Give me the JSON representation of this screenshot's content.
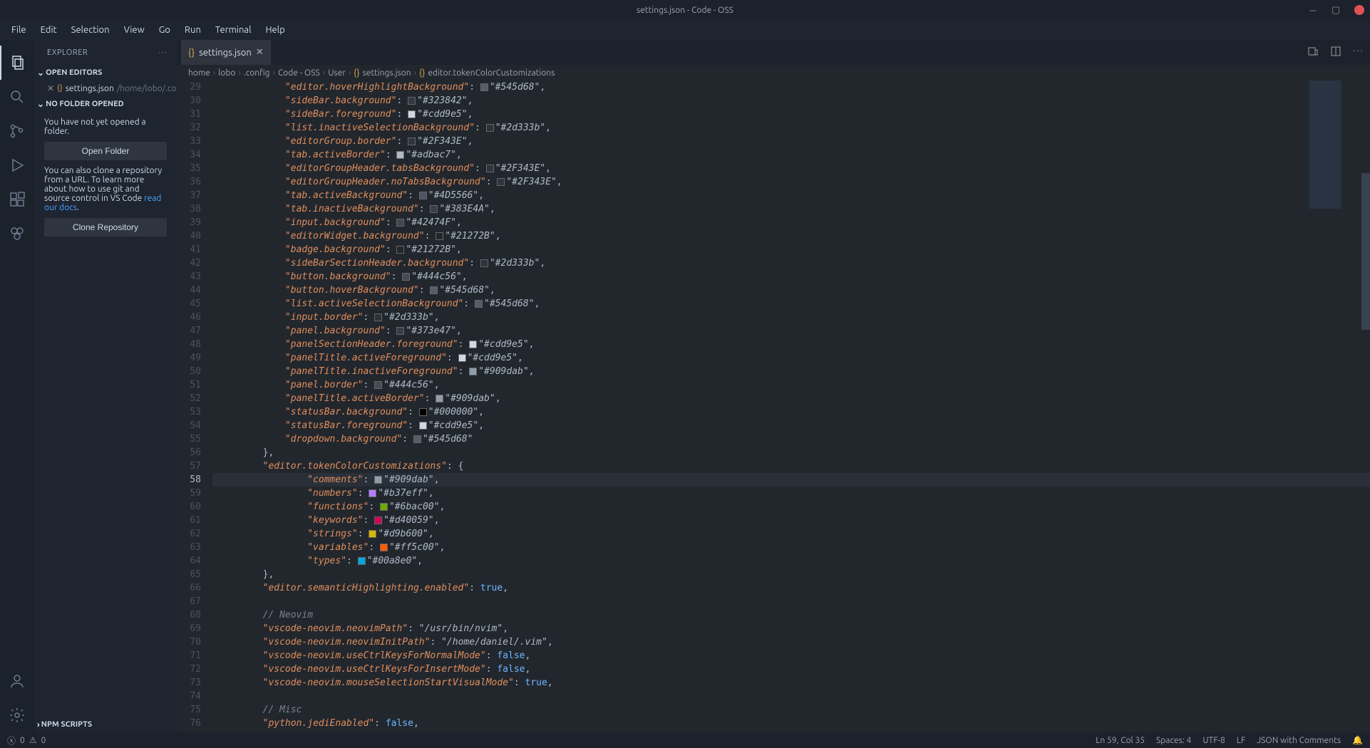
{
  "title": "settings.json - Code - OSS",
  "menubar": [
    "File",
    "Edit",
    "Selection",
    "View",
    "Go",
    "Run",
    "Terminal",
    "Help"
  ],
  "sidebar": {
    "header": "EXPLORER",
    "open_editors": "OPEN EDITORS",
    "open_item_name": "settings.json",
    "open_item_path": "/home/lobo/.config/Co...",
    "no_folder": "NO FOLDER OPENED",
    "msg1": "You have not yet opened a folder.",
    "btn_open": "Open Folder",
    "msg2_a": "You can also clone a repository from a URL. To learn more about how to use git and source control in VS Code ",
    "msg2_link": "read our docs",
    "msg2_b": ".",
    "btn_clone": "Clone Repository",
    "npm_scripts": "NPM SCRIPTS"
  },
  "tab_name": "settings.json",
  "breadcrumb": [
    "home",
    "lobo",
    ".config",
    "Code - OSS",
    "User",
    "settings.json",
    "editor.tokenColorCustomizations"
  ],
  "code_start_line": 29,
  "code": [
    {
      "indent": 3,
      "key": "editor.hoverHighlightBackground",
      "val": "#545d68",
      "comma": true
    },
    {
      "indent": 3,
      "key": "sideBar.background",
      "val": "#323842",
      "comma": true
    },
    {
      "indent": 3,
      "key": "sideBar.foreground",
      "val": "#cdd9e5",
      "comma": true
    },
    {
      "indent": 3,
      "key": "list.inactiveSelectionBackground",
      "val": "#2d333b",
      "comma": true
    },
    {
      "indent": 3,
      "key": "editorGroup.border",
      "val": "#2F343E",
      "comma": true
    },
    {
      "indent": 3,
      "key": "tab.activeBorder",
      "val": "#adbac7",
      "comma": true
    },
    {
      "indent": 3,
      "key": "editorGroupHeader.tabsBackground",
      "val": "#2F343E",
      "comma": true
    },
    {
      "indent": 3,
      "key": "editorGroupHeader.noTabsBackground",
      "val": "#2F343E",
      "comma": true
    },
    {
      "indent": 3,
      "key": "tab.activeBackground",
      "val": "#4D5566",
      "comma": true
    },
    {
      "indent": 3,
      "key": "tab.inactiveBackground",
      "val": "#383E4A",
      "comma": true
    },
    {
      "indent": 3,
      "key": "input.background",
      "val": "#42474F",
      "comma": true
    },
    {
      "indent": 3,
      "key": "editorWidget.background",
      "val": "#21272B",
      "comma": true
    },
    {
      "indent": 3,
      "key": "badge.background",
      "val": "#21272B",
      "comma": true
    },
    {
      "indent": 3,
      "key": "sideBarSectionHeader.background",
      "val": "#2d333b",
      "comma": true
    },
    {
      "indent": 3,
      "key": "button.background",
      "val": "#444c56",
      "comma": true
    },
    {
      "indent": 3,
      "key": "button.hoverBackground",
      "val": "#545d68",
      "comma": true
    },
    {
      "indent": 3,
      "key": "list.activeSelectionBackground",
      "val": "#545d68",
      "comma": true
    },
    {
      "indent": 3,
      "key": "input.border",
      "val": "#2d333b",
      "comma": true
    },
    {
      "indent": 3,
      "key": "panel.background",
      "val": "#373e47",
      "comma": true
    },
    {
      "indent": 3,
      "key": "panelSectionHeader.foreground",
      "val": "#cdd9e5",
      "comma": true
    },
    {
      "indent": 3,
      "key": "panelTitle.activeForeground",
      "val": "#cdd9e5",
      "comma": true
    },
    {
      "indent": 3,
      "key": "panelTitle.inactiveForeground",
      "val": "#909dab",
      "comma": true
    },
    {
      "indent": 3,
      "key": "panel.border",
      "val": "#444c56",
      "comma": true
    },
    {
      "indent": 3,
      "key": "panelTitle.activeBorder",
      "val": "#909dab",
      "comma": true
    },
    {
      "indent": 3,
      "key": "statusBar.background",
      "val": "#000000",
      "comma": true
    },
    {
      "indent": 3,
      "key": "statusBar.foreground",
      "val": "#cdd9e5",
      "comma": true
    },
    {
      "indent": 3,
      "key": "dropdown.background",
      "val": "#545d68",
      "comma": false
    },
    {
      "indent": 2,
      "raw": "},"
    },
    {
      "indent": 2,
      "key": "editor.tokenColorCustomizations",
      "open": true
    },
    {
      "indent": 4,
      "key": "comments",
      "val": "#909dab",
      "comma": true,
      "hl": true
    },
    {
      "indent": 4,
      "key": "numbers",
      "val": "#b37eff",
      "comma": true
    },
    {
      "indent": 4,
      "key": "functions",
      "val": "#6bac00",
      "comma": true
    },
    {
      "indent": 4,
      "key": "keywords",
      "val": "#d40059",
      "comma": true
    },
    {
      "indent": 4,
      "key": "strings",
      "val": "#d9b600",
      "comma": true
    },
    {
      "indent": 4,
      "key": "variables",
      "val": "#ff5c00",
      "comma": true
    },
    {
      "indent": 4,
      "key": "types",
      "val": "#00a8e0",
      "comma": true
    },
    {
      "indent": 2,
      "raw": "},"
    },
    {
      "indent": 2,
      "key": "editor.semanticHighlighting.enabled",
      "bool": "true",
      "comma": true
    },
    {
      "indent": 0,
      "raw": ""
    },
    {
      "indent": 2,
      "comment": "// Neovim"
    },
    {
      "indent": 2,
      "key": "vscode-neovim.neovimPath",
      "str": "/usr/bin/nvim",
      "comma": true
    },
    {
      "indent": 2,
      "key": "vscode-neovim.neovimInitPath",
      "str": "/home/daniel/.vim",
      "comma": true
    },
    {
      "indent": 2,
      "key": "vscode-neovim.useCtrlKeysForNormalMode",
      "bool": "false",
      "comma": true
    },
    {
      "indent": 2,
      "key": "vscode-neovim.useCtrlKeysForInsertMode",
      "bool": "false",
      "comma": true
    },
    {
      "indent": 2,
      "key": "vscode-neovim.mouseSelectionStartVisualMode",
      "bool": "true",
      "comma": true
    },
    {
      "indent": 0,
      "raw": ""
    },
    {
      "indent": 2,
      "comment": "// Misc"
    },
    {
      "indent": 2,
      "key": "python.jediEnabled",
      "bool": "false",
      "comma": true
    }
  ],
  "statusbar": {
    "errors": "0",
    "warnings": "0",
    "lncol": "Ln 59, Col 35",
    "spaces": "Spaces: 4",
    "enc": "UTF-8",
    "eol": "LF",
    "lang": "JSON with Comments"
  }
}
